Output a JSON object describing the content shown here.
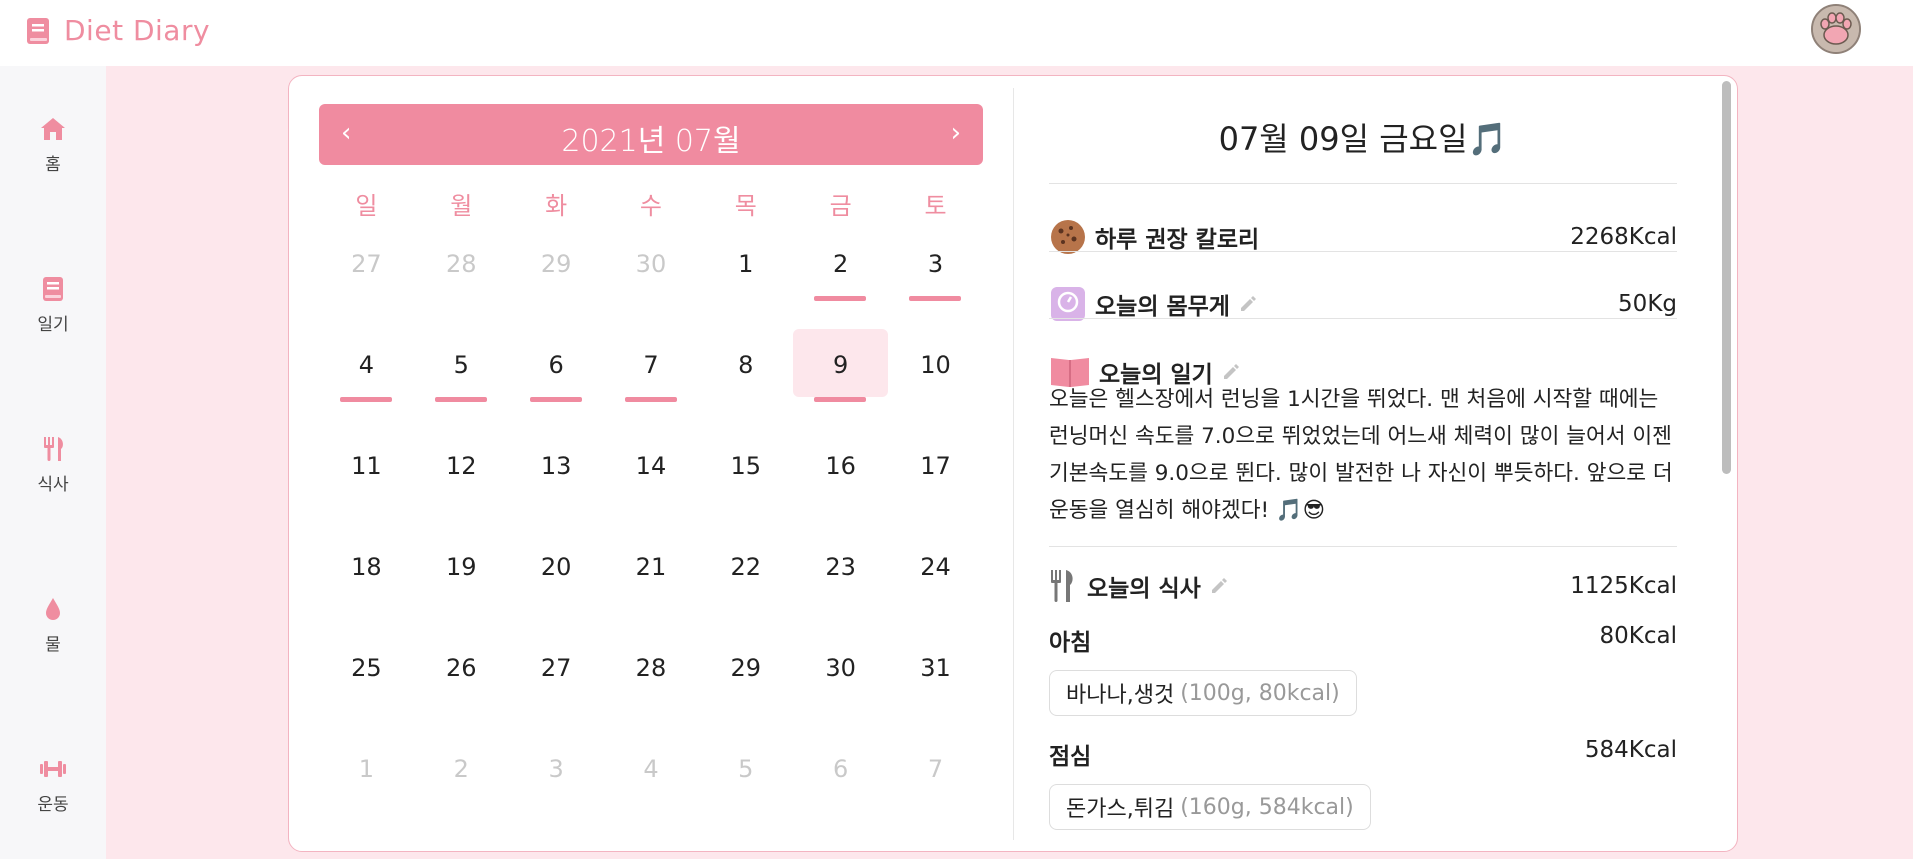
{
  "app": {
    "title": "Diet Diary"
  },
  "sidebar": {
    "items": [
      {
        "label": "홈",
        "icon": "home-icon"
      },
      {
        "label": "일기",
        "icon": "book-icon"
      },
      {
        "label": "식사",
        "icon": "utensils-icon"
      },
      {
        "label": "물",
        "icon": "water-drop-icon"
      },
      {
        "label": "운동",
        "icon": "dumbbell-icon"
      }
    ]
  },
  "calendar": {
    "title": "2021년 07월",
    "prev_label": "‹",
    "next_label": "›",
    "weekdays": [
      "일",
      "월",
      "화",
      "수",
      "목",
      "금",
      "토"
    ],
    "days": [
      {
        "label": "27",
        "other": true
      },
      {
        "label": "28",
        "other": true
      },
      {
        "label": "29",
        "other": true
      },
      {
        "label": "30",
        "other": true
      },
      {
        "label": "1"
      },
      {
        "label": "2",
        "marked": true
      },
      {
        "label": "3",
        "marked": true
      },
      {
        "label": "4",
        "marked": true
      },
      {
        "label": "5",
        "marked": true
      },
      {
        "label": "6",
        "marked": true
      },
      {
        "label": "7",
        "marked": true
      },
      {
        "label": "8"
      },
      {
        "label": "9",
        "marked": true,
        "selected": true
      },
      {
        "label": "10"
      },
      {
        "label": "11"
      },
      {
        "label": "12"
      },
      {
        "label": "13"
      },
      {
        "label": "14"
      },
      {
        "label": "15"
      },
      {
        "label": "16"
      },
      {
        "label": "17"
      },
      {
        "label": "18"
      },
      {
        "label": "19"
      },
      {
        "label": "20"
      },
      {
        "label": "21"
      },
      {
        "label": "22"
      },
      {
        "label": "23"
      },
      {
        "label": "24"
      },
      {
        "label": "25"
      },
      {
        "label": "26"
      },
      {
        "label": "27"
      },
      {
        "label": "28"
      },
      {
        "label": "29"
      },
      {
        "label": "30"
      },
      {
        "label": "31"
      },
      {
        "label": "1",
        "other": true
      },
      {
        "label": "2",
        "other": true
      },
      {
        "label": "3",
        "other": true
      },
      {
        "label": "4",
        "other": true
      },
      {
        "label": "5",
        "other": true
      },
      {
        "label": "6",
        "other": true
      },
      {
        "label": "7",
        "other": true
      }
    ]
  },
  "detail": {
    "date_title": "07월 09일 금요일🎵",
    "calorie": {
      "label": "하루 권장 칼로리",
      "value": "2268Kcal",
      "icon": "cookie-icon"
    },
    "weight": {
      "label": "오늘의 몸무게",
      "value": "50Kg",
      "icon": "scale-icon"
    },
    "diary": {
      "label": "오늘의 일기",
      "icon": "open-book-icon",
      "text": "오늘은 헬스장에서 런닝을 1시간을 뛰었다. 맨 처음에 시작할 때에는 런닝머신 속도를 7.0으로 뛰었었는데 어느새 체력이 많이 늘어서 이젠 기본속도를 9.0으로 뛴다. 많이 발전한 나 자신이 뿌듯하다. 앞으로 더 운동을 열심히 해야겠다! 🎵😎"
    },
    "meal": {
      "label": "오늘의 식사",
      "value": "1125Kcal",
      "icon": "utensils-icon",
      "items": [
        {
          "name": "아침",
          "kcal": "80Kcal",
          "food": "바나나,생것",
          "info": "(100g, 80kcal)"
        },
        {
          "name": "점심",
          "kcal": "584Kcal",
          "food": "돈가스,튀김",
          "info": "(160g, 584kcal)"
        }
      ]
    }
  },
  "colors": {
    "accent": "#f08ba0",
    "page_bg": "#fde7ec",
    "selected_bg": "#fde7ec"
  }
}
